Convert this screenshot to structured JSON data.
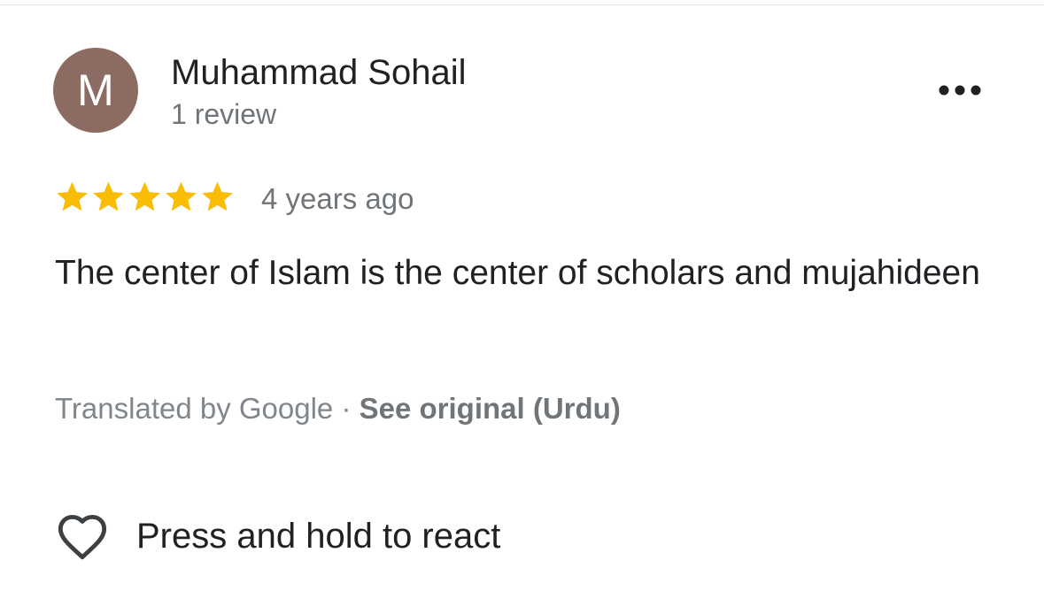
{
  "reviewer": {
    "avatar_initial": "M",
    "avatar_color": "#8c6c62",
    "name": "Muhammad Sohail",
    "review_count": "1 review"
  },
  "review": {
    "rating": 5,
    "rating_max": 5,
    "star_color": "#fbbc04",
    "age": "4 years ago",
    "text": "The center of Islam is the center of scholars and mujahideen",
    "translated_by": "Translated by Google · ",
    "see_original": "See original (Urdu)"
  },
  "actions": {
    "more_icon": "more-horizontal-icon",
    "react_icon": "heart-outline-icon",
    "react_label": "Press and hold to react"
  }
}
